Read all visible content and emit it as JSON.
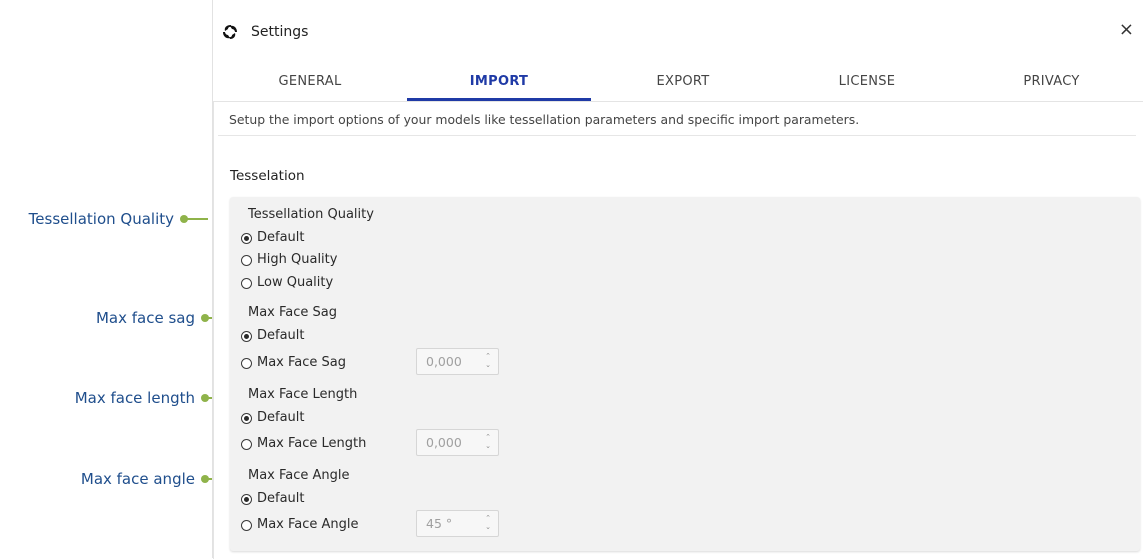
{
  "callouts": {
    "tessellation_quality": "Tessellation Quality",
    "max_face_sag": "Max face sag",
    "max_face_length": "Max face length",
    "max_face_angle": "Max face angle"
  },
  "window": {
    "title": "Settings",
    "close": "×",
    "app_icon": "app-logo-icon"
  },
  "tabs": [
    {
      "label": "GENERAL",
      "active": false
    },
    {
      "label": "IMPORT",
      "active": true
    },
    {
      "label": "EXPORT",
      "active": false
    },
    {
      "label": "LICENSE",
      "active": false
    },
    {
      "label": "PRIVACY",
      "active": false
    }
  ],
  "description": "Setup the import options of your models like tessellation parameters and specific import parameters.",
  "section_title": "Tesselation",
  "groups": {
    "quality": {
      "label": "Tessellation Quality",
      "options": [
        "Default",
        "High Quality",
        "Low Quality"
      ],
      "selected": "Default"
    },
    "sag": {
      "label": "Max Face Sag",
      "options": [
        "Default",
        "Max Face Sag"
      ],
      "selected": "Default",
      "value": "0,000"
    },
    "length": {
      "label": "Max Face Length",
      "options": [
        "Default",
        "Max Face Length"
      ],
      "selected": "Default",
      "value": "0,000"
    },
    "angle": {
      "label": "Max Face Angle",
      "options": [
        "Default",
        "Max Face Angle"
      ],
      "selected": "Default",
      "value": "45 °"
    }
  },
  "spinner_arrows": {
    "up": "⌃",
    "down": "⌄"
  },
  "colors": {
    "accent": "#1f3aa6",
    "callout_text": "#1f4e8c",
    "callout_marker": "#8fb34a",
    "panel_bg": "#f2f2f2"
  }
}
